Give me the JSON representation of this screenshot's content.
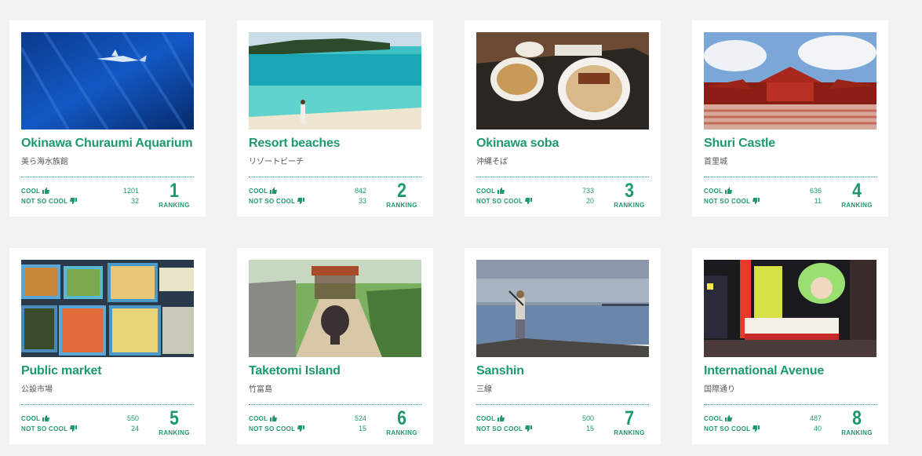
{
  "labels": {
    "cool": "COOL",
    "not_cool": "NOT SO COOL",
    "ranking": "RANKING"
  },
  "colors": {
    "accent": "#1d9a6c",
    "background": "#f2f2f2",
    "card": "#ffffff"
  },
  "spots": [
    {
      "name": "Okinawa Churaumi Aquarium",
      "name_ja": "美ら海水族館",
      "cool": "1201",
      "not_cool": "32",
      "rank": "1",
      "photo": "aquarium-photo"
    },
    {
      "name": "Resort beaches",
      "name_ja": "リゾートビーチ",
      "cool": "842",
      "not_cool": "33",
      "rank": "2",
      "photo": "beach-photo"
    },
    {
      "name": "Okinawa soba",
      "name_ja": "沖縄そば",
      "cool": "733",
      "not_cool": "20",
      "rank": "3",
      "photo": "soba-photo"
    },
    {
      "name": "Shuri Castle",
      "name_ja": "首里城",
      "cool": "636",
      "not_cool": "11",
      "rank": "4",
      "photo": "castle-photo"
    },
    {
      "name": "Public market",
      "name_ja": "公設市場",
      "cool": "550",
      "not_cool": "24",
      "rank": "5",
      "photo": "market-photo"
    },
    {
      "name": "Taketomi Island",
      "name_ja": "竹富島",
      "cool": "524",
      "not_cool": "15",
      "rank": "6",
      "photo": "island-photo"
    },
    {
      "name": "Sanshin",
      "name_ja": "三線",
      "cool": "500",
      "not_cool": "15",
      "rank": "7",
      "photo": "sanshin-photo"
    },
    {
      "name": "International Avenue",
      "name_ja": "国際通り",
      "cool": "487",
      "not_cool": "40",
      "rank": "8",
      "photo": "avenue-photo"
    }
  ]
}
